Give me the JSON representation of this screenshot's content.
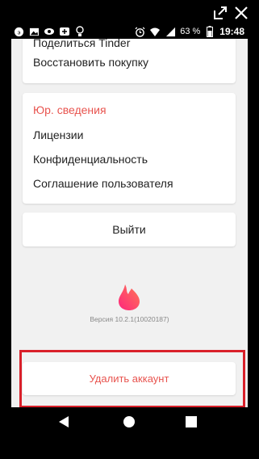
{
  "status_bar": {
    "battery_percent": "63 %",
    "time": "19:48"
  },
  "menu": {
    "share_label": "Поделиться Tinder",
    "restore_label": "Восстановить покупку",
    "legal_header": "Юр. сведения",
    "licenses_label": "Лицензии",
    "privacy_label": "Конфиденциальность",
    "terms_label": "Соглашение пользователя"
  },
  "logout_label": "Выйти",
  "version_text": "Версия 10.2.1(10020187)",
  "delete_label": "Удалить аккаунт",
  "colors": {
    "accent": "#e8544f",
    "highlight": "#d9202a",
    "screen_bg": "#f1f1f1"
  },
  "icons": [
    "expand-icon",
    "close-icon",
    "back-icon",
    "home-icon",
    "recents-icon",
    "tinder-flame-icon"
  ]
}
